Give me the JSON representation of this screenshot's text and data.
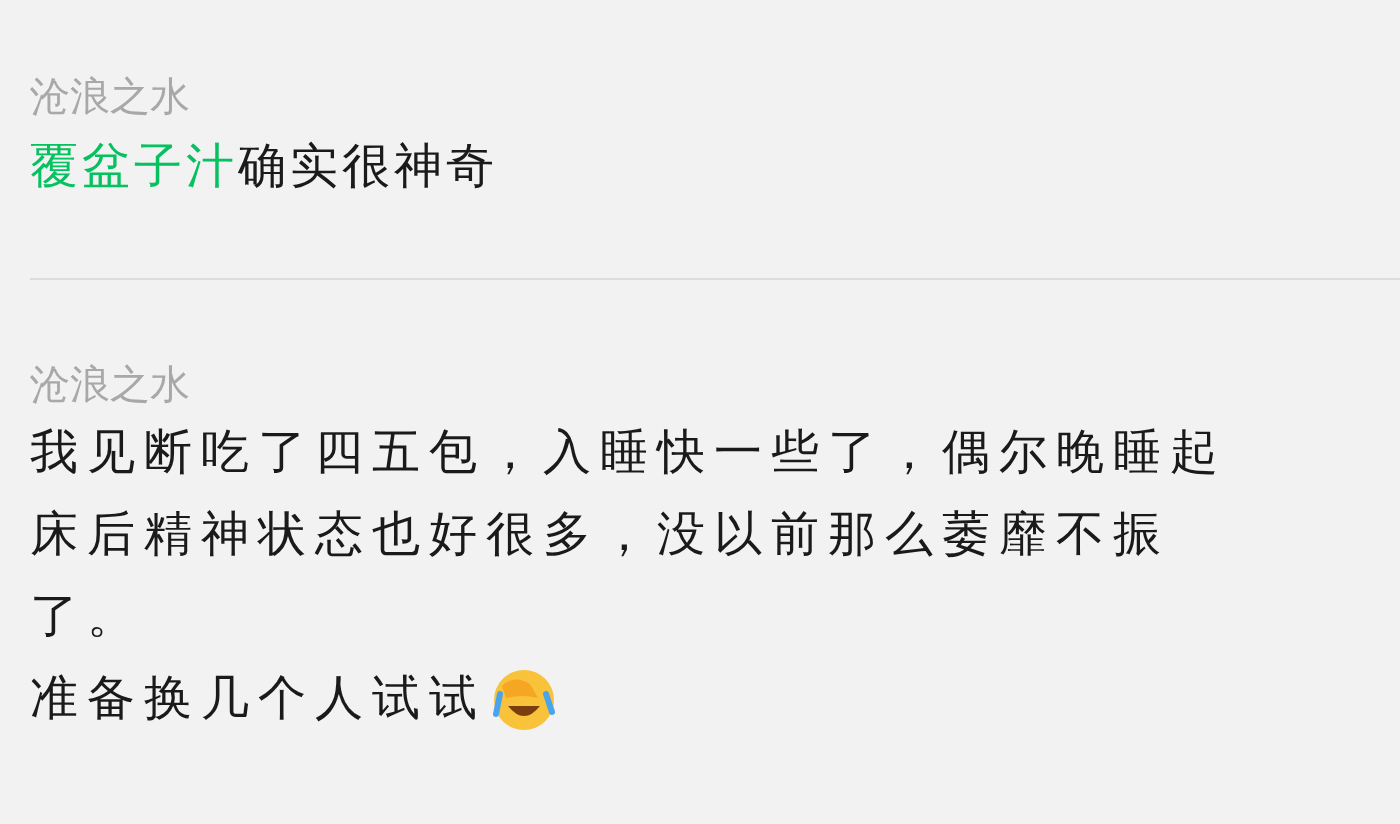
{
  "comments": [
    {
      "author": "沧浪之水",
      "segments": [
        {
          "kind": "link",
          "text": "覆盆子汁"
        },
        {
          "kind": "plain",
          "text": "确实很神奇"
        }
      ]
    },
    {
      "author": "沧浪之水",
      "paragraphs": [
        "我见断吃了四五包，入睡快一些了，偶尔晚睡起床后精神状态也好很多，没以前那么萎靡不振了。",
        "准备换几个人试试"
      ],
      "trailing_emoji": true
    }
  ]
}
